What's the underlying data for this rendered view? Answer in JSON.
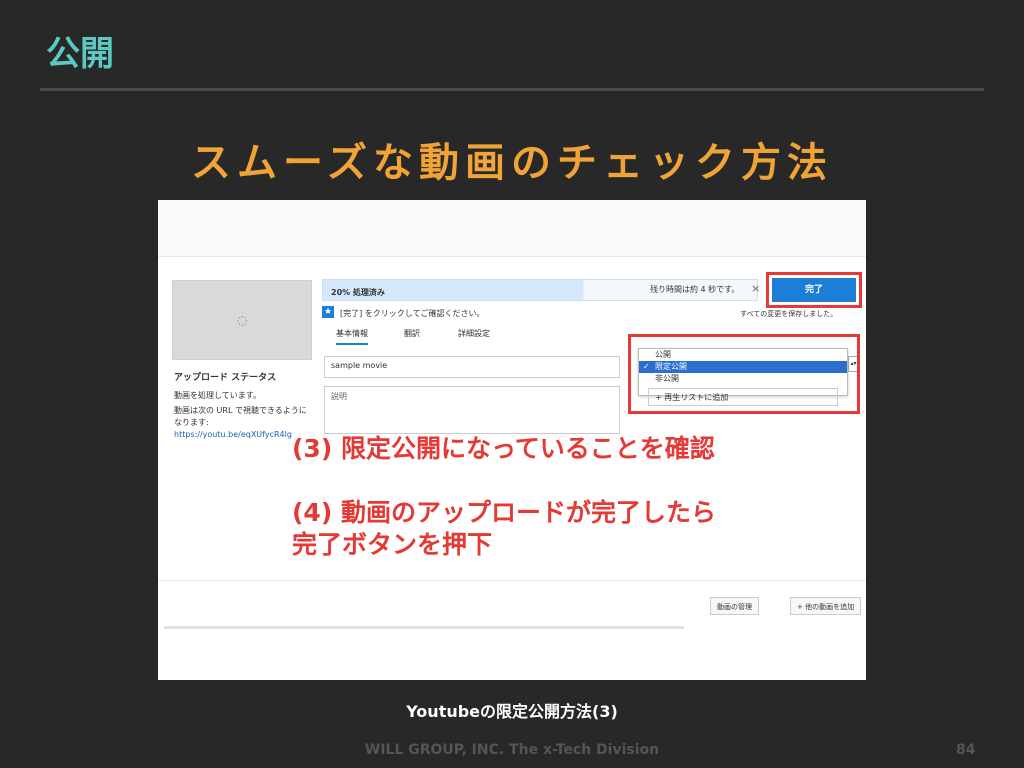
{
  "heading": "公開",
  "title": "スムーズな動画のチェック方法",
  "screenshot": {
    "progress_label": "20% 処理済み",
    "remaining": "残り時間は約 4 秒です。",
    "close": "×",
    "done_button": "完了",
    "star": "★",
    "instruction": "[完了] をクリックしてご確認ください。",
    "saved": "すべての変更を保存しました。",
    "tabs": [
      "基本情報",
      "翻訳",
      "詳細設定"
    ],
    "title_value": "sample movie",
    "description_placeholder": "説明",
    "visibility_options": [
      "公開",
      "限定公開",
      "非公開"
    ],
    "visibility_selected": "限定公開",
    "check_mark": "✓",
    "select_arrow": "▴▾",
    "add_to_playlist": "+ 再生リストに追加",
    "status_heading": "アップロード ステータス",
    "status_processing": "動画を処理しています。",
    "status_url_note": "動画は次の URL で視聴できるように",
    "status_url_note2": "なります:",
    "status_url": "https://youtu.be/eqXUfycR4lg",
    "spinner": "◌",
    "manage_button": "動画の管理",
    "add_more_button": "+ 他の動画を追加"
  },
  "annotation_1": "(3) 限定公開になっていることを確認",
  "annotation_2_line1": "(4) 動画のアップロードが完了したら",
  "annotation_2_line2": "完了ボタンを押下",
  "caption": "Youtubeの限定公開方法(3)",
  "footer": "WILL GROUP, INC. The x-Tech Division",
  "page_number": "84"
}
